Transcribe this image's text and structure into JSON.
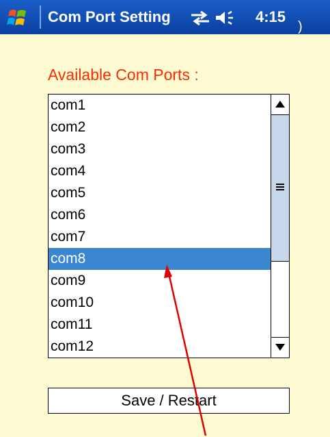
{
  "titlebar": {
    "title": "Com Port Setting",
    "clock": "4:15",
    "tail": ")",
    "icons": [
      "windows-start-icon",
      "connectivity-icon",
      "volume-icon"
    ]
  },
  "main": {
    "ports_label": "Available Com Ports :",
    "ports": [
      "com1",
      "com2",
      "com3",
      "com4",
      "com5",
      "com6",
      "com7",
      "com8",
      "com9",
      "com10",
      "com11",
      "com12"
    ],
    "selected_port": "com8",
    "save_label": "Save / Restart"
  },
  "colors": {
    "titlebar": "#0a3f9f",
    "background": "#fffbd2",
    "label": "#ff2a00",
    "selection": "#3c86d0",
    "scroll_thumb": "#c8d8ec",
    "annotation_arrow": "#e00000"
  }
}
